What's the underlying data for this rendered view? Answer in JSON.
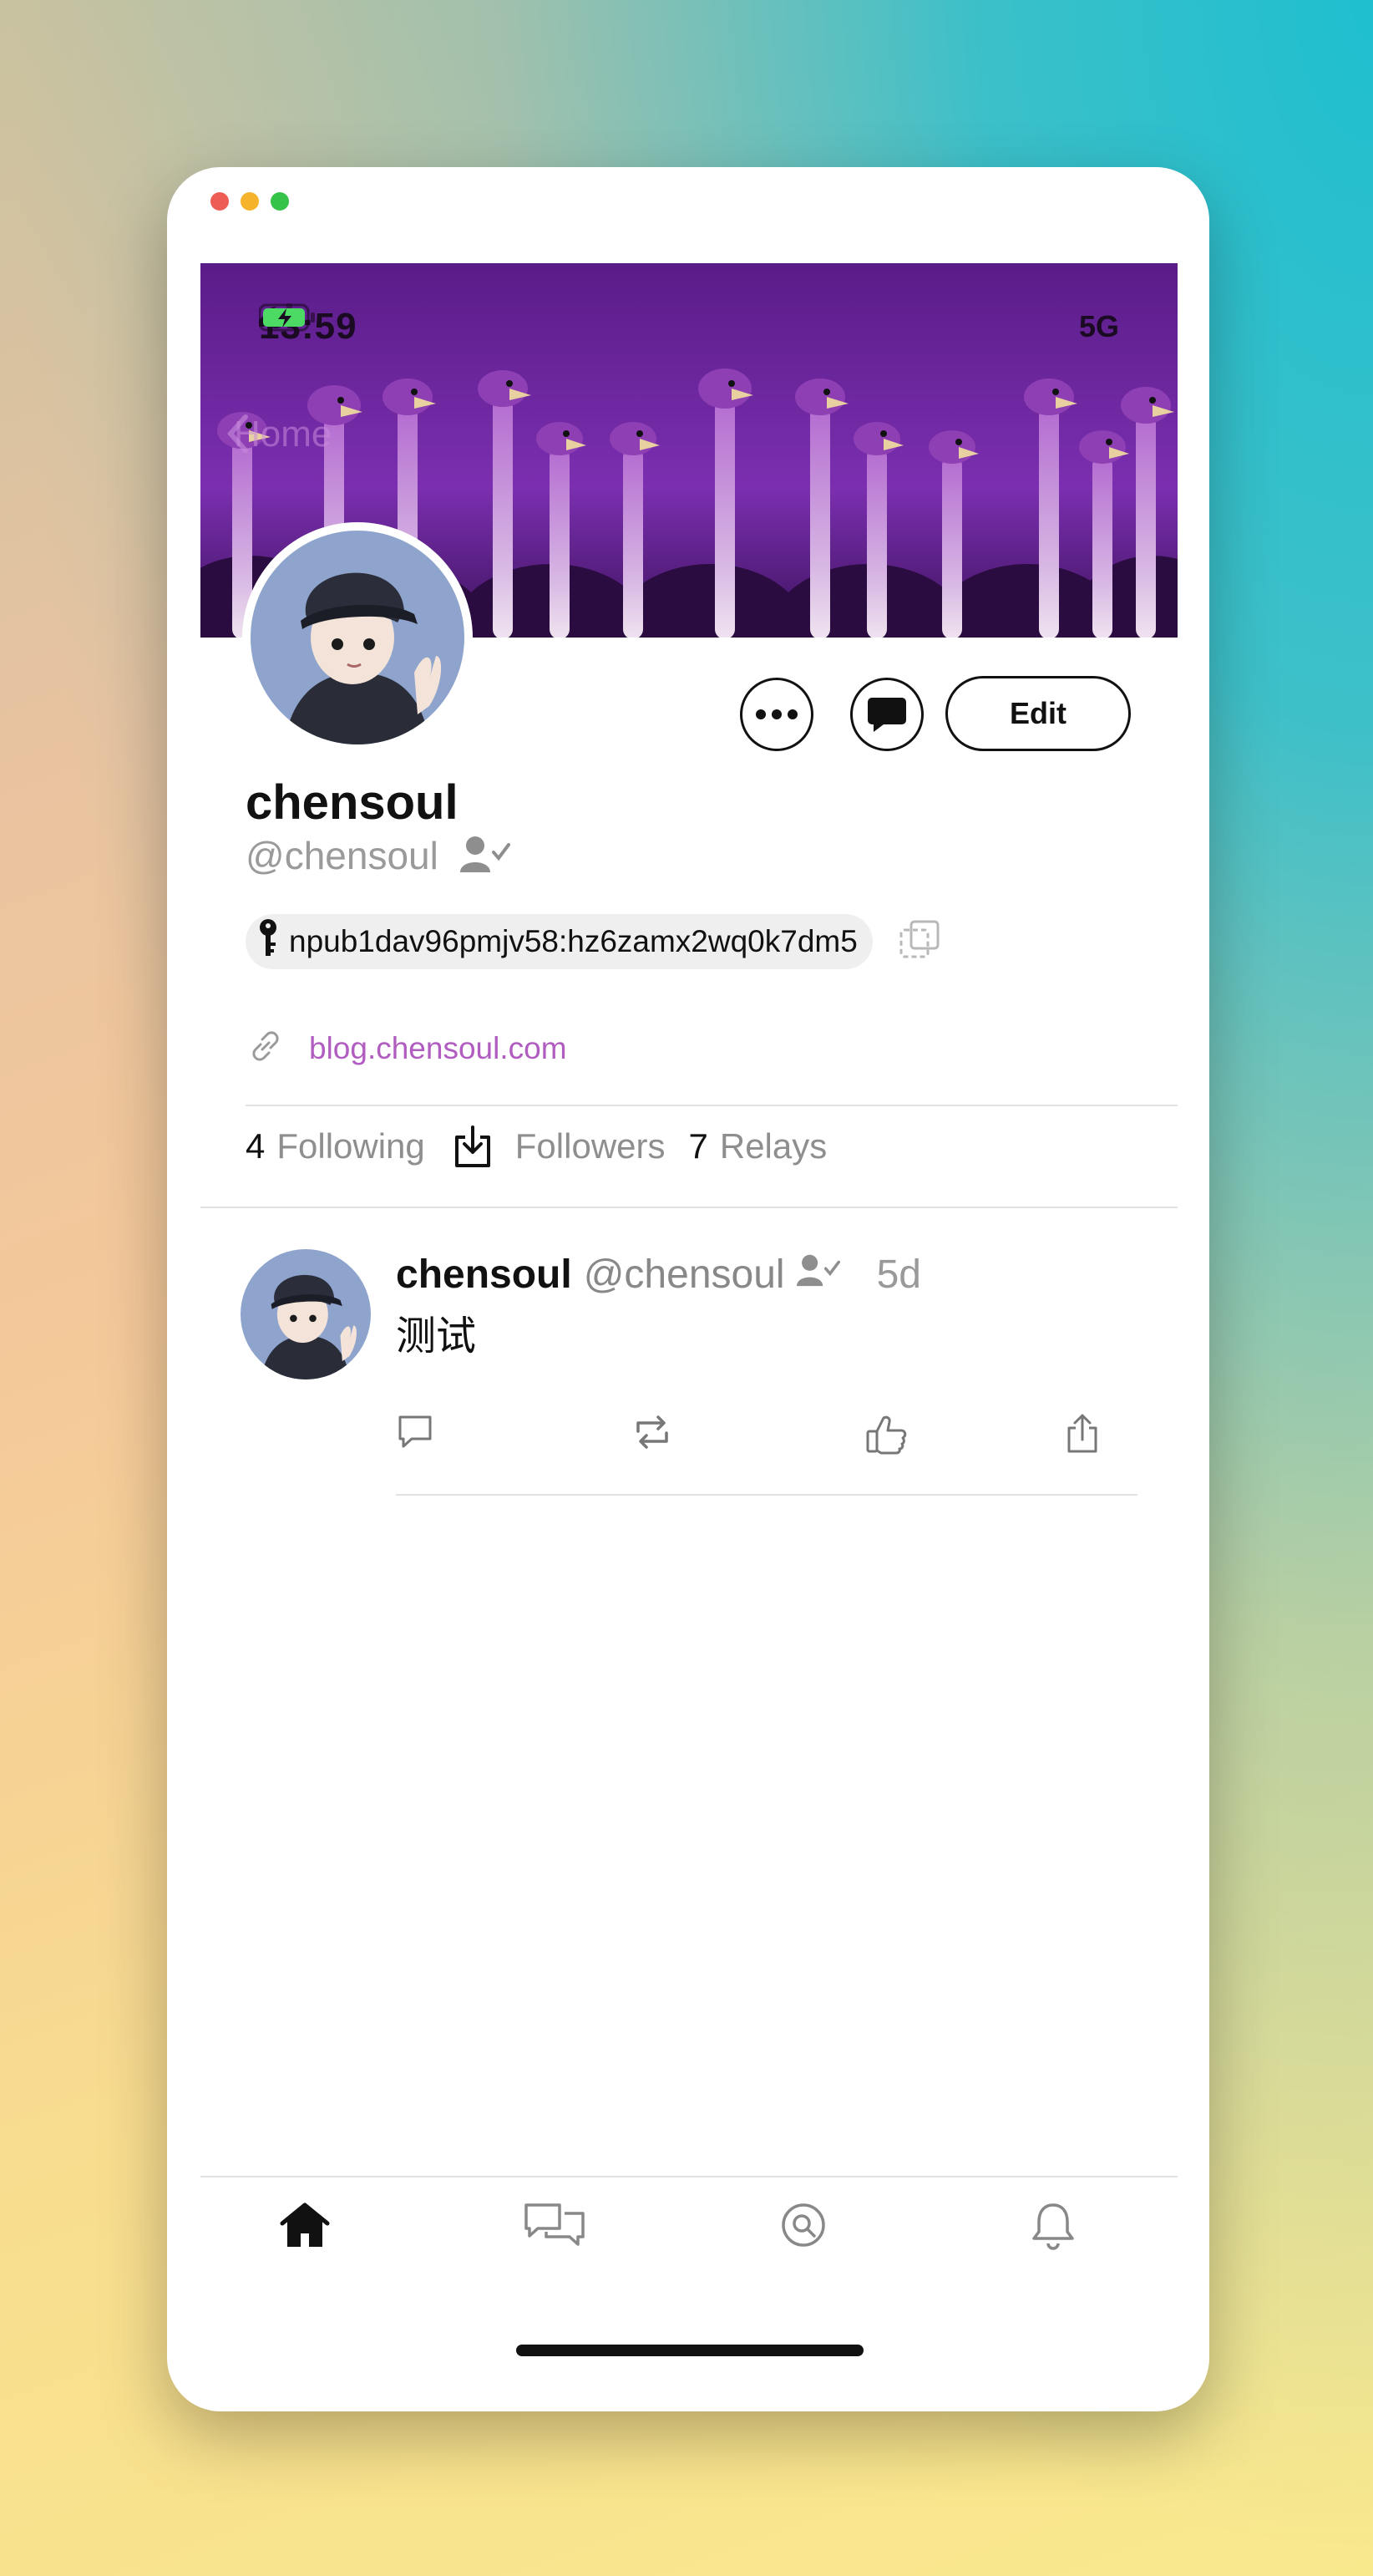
{
  "window": {
    "traffic_lights": {
      "close": "#ee5c56",
      "minimize": "#f5b32b",
      "zoom": "#35c34a"
    }
  },
  "status_bar": {
    "time": "13:59",
    "network": "5G",
    "moon_icon": "moon-icon",
    "signal_icon": "cellular-signal-icon",
    "battery_icon": "battery-charging-icon"
  },
  "nav": {
    "back_label": "Home"
  },
  "profile": {
    "display_name": "chensoul",
    "handle": "@chensoul",
    "npub": "npub1dav96pmjv58:hz6zamx2wq0k7dm5",
    "website": "blog.chensoul.com",
    "edit_label": "Edit",
    "stats": {
      "following_count": "4",
      "following_label": "Following",
      "followers_label": "Followers",
      "relays_count": "7",
      "relays_label": "Relays"
    }
  },
  "post": {
    "author_name": "chensoul",
    "author_handle": "@chensoul",
    "time": "5d",
    "content": "测试"
  },
  "colors": {
    "accent_link": "#b15cc0",
    "banner": "#6a24a0",
    "separator": "#e2e2e2",
    "battery_green": "#4cd964"
  }
}
